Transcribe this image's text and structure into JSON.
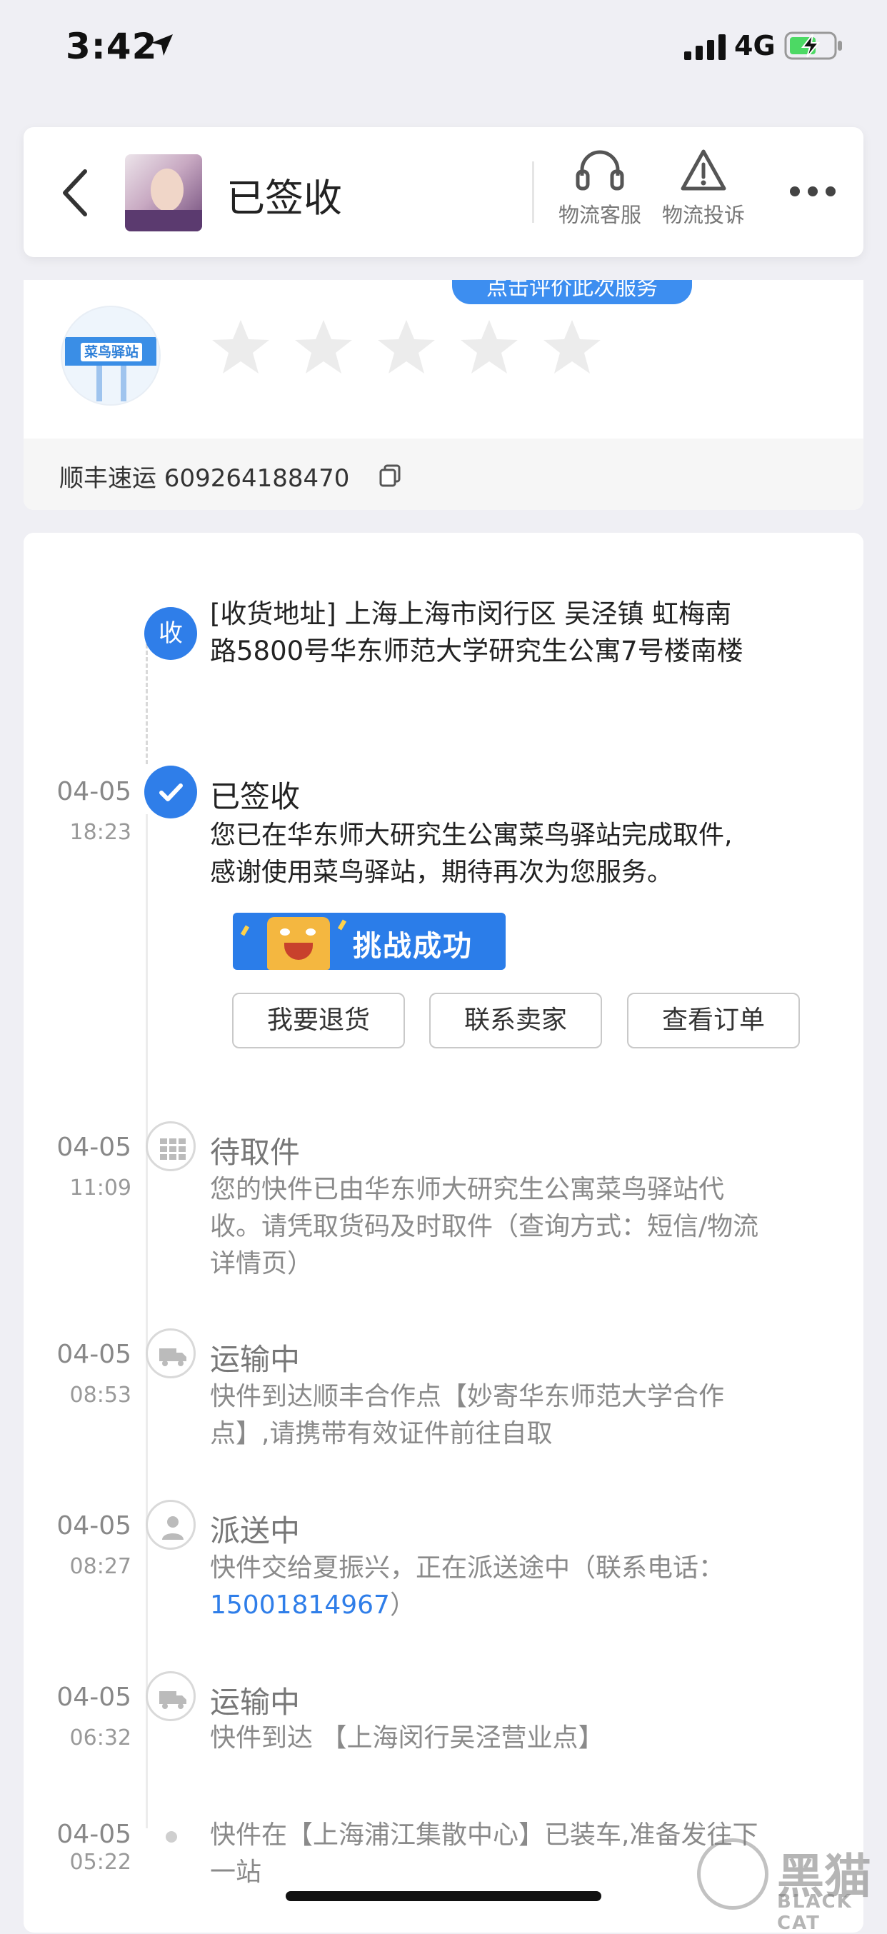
{
  "status_bar": {
    "time": "3:42",
    "network": "4G"
  },
  "header": {
    "title": "已签收",
    "service_label": "物流客服",
    "complaint_label": "物流投诉"
  },
  "rating": {
    "prompt": "点击评价此次服务",
    "stars_total": 5,
    "stars_filled": 0,
    "station_sign": "菜鸟驿站"
  },
  "carrier": {
    "text": "顺丰速运 609264188470"
  },
  "timeline": {
    "address": {
      "node_label": "收",
      "line1": "[收货地址] 上海上海市闵行区  吴泾镇   虹梅南",
      "line2": "路5800号华东师范大学研究生公寓7号楼南楼"
    },
    "events": [
      {
        "date": "04-05",
        "time": "18:23",
        "status": "已签收",
        "lines": [
          "您已在华东师大研究生公寓菜鸟驿站完成取件,",
          "感谢使用菜鸟驿站，期待再次为您服务。"
        ]
      },
      {
        "date": "04-05",
        "time": "11:09",
        "status": "待取件",
        "lines": [
          "您的快件已由华东师大研究生公寓菜鸟驿站代",
          "收。请凭取货码及时取件（查询方式：短信/物流",
          "详情页）"
        ]
      },
      {
        "date": "04-05",
        "time": "08:53",
        "status": "运输中",
        "lines": [
          "快件到达顺丰合作点【妙寄华东师范大学合作",
          "点】,请携带有效证件前往自取"
        ]
      },
      {
        "date": "04-05",
        "time": "08:27",
        "status": "派送中",
        "lines": [
          "快件交给夏振兴，正在派送途中（联系电话："
        ],
        "phone": "15001814967",
        "phone_suffix": "）"
      },
      {
        "date": "04-05",
        "time": "06:32",
        "status": "运输中",
        "lines": [
          "快件到达 【上海闵行吴泾营业点】"
        ]
      },
      {
        "date": "04-05",
        "time": "05:22",
        "lines": [
          "快件在【上海浦江集散中心】已装车,准备发往下",
          "一站"
        ]
      }
    ]
  },
  "challenge_banner": {
    "text": "挑战成功"
  },
  "actions": {
    "return": "我要退货",
    "contact": "联系卖家",
    "order": "查看订单"
  },
  "watermark": {
    "cn": "黑猫",
    "en": "BLACK CAT"
  },
  "colors": {
    "accent": "#2f7ee9",
    "background": "#efeff4"
  }
}
